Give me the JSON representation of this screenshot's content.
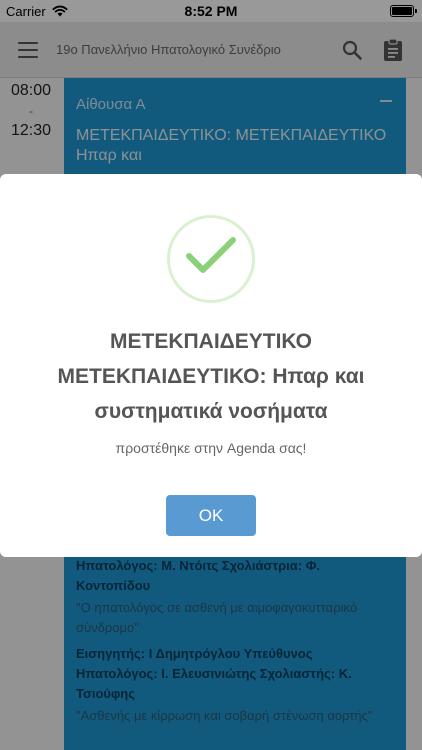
{
  "status_bar": {
    "carrier": "Carrier",
    "time": "8:52 PM"
  },
  "app_bar": {
    "title": "19ο Πανελλήνιο Ηπατολογικό Συνέδριο"
  },
  "schedule": {
    "start_time": "08:00",
    "separator": "-",
    "end_time": "12:30",
    "room": "Αίθουσα Α",
    "event_title": "ΜΕΤΕΚΠΑΙΔΕΥΤΙΚΟ: ΜΕΤΕΚΠΑΙΔΕΥΤΙΚΟ Ηπαρ και",
    "items": [
      {
        "speaker": "Ηπατολόγος: Μ. Ντόιτς Σχολιάστρια: Φ. Κοντοπίδου",
        "talk": "\"Ο ηπατολόγος σε ασθενή με αιμοφαγοκυτταρικό σύνδρομο\""
      },
      {
        "speaker": "Εισηγητής: Ι Δημητρόγλου Υπεύθυνος Ηπατολόγος: Ι. Ελευσινιώτης Σχολιαστής: Κ. Τσιούφης",
        "talk": "\"Ασθενής με κίρρωση και σοβαρή στένωση αορτής\""
      }
    ]
  },
  "dialog": {
    "title": "ΜΕΤΕΚΠΑΙΔΕΥΤΙΚΟ ΜΕΤΕΚΠΑΙΔΕΥΤΙΚΟ: Ηπαρ και συστηματικά νοσήματα",
    "message": "προστέθηκε στην Agenda σας!",
    "ok_label": "OK",
    "icon": "check-icon",
    "check_color": "#8bd17a"
  }
}
